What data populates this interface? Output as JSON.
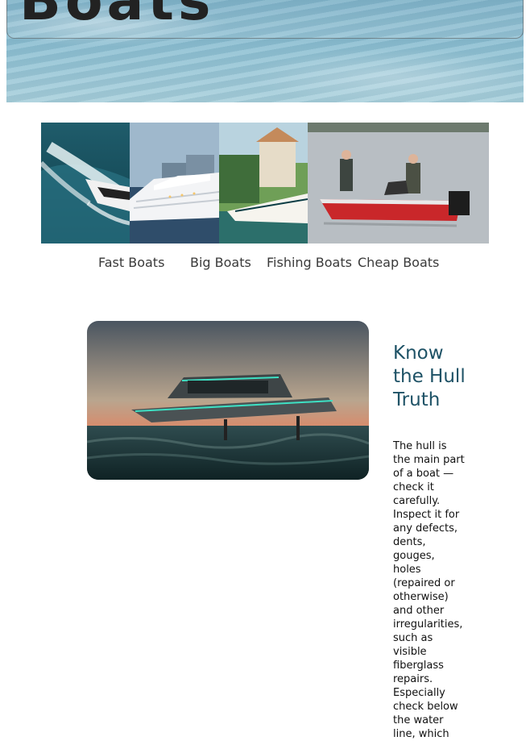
{
  "hero": {
    "title": "Boats"
  },
  "categories": [
    {
      "label": "Fast Boats",
      "image": "speedboat-photo"
    },
    {
      "label": "Big Boats",
      "image": "cruise-ship-photo"
    },
    {
      "label": "Fishing Boats",
      "image": "fishing-yacht-photo"
    },
    {
      "label": "Cheap Boats",
      "image": "small-fishing-boat-photo"
    }
  ],
  "article": {
    "image": "foiling-electric-boat-photo",
    "title": "Know the Hull Truth",
    "body": "The hull is the main part of a boat — check it carefully. Inspect it for any defects, dents, gouges, holes (repaired or otherwise) and other irregularities, such as visible fiberglass repairs. Especially check below the water line, which"
  },
  "colors": {
    "title_accent": "#1e5266",
    "hero_water": "#8ec0d3"
  }
}
